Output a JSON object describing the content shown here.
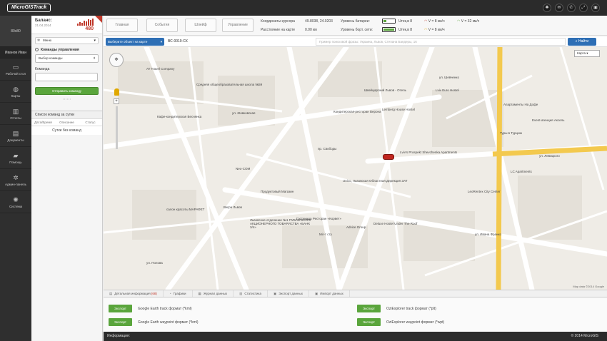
{
  "app": {
    "logo": "MicroGISTrack",
    "footer_label": "Информация:",
    "copyright": "© 2014 MicroGIS"
  },
  "user": {
    "avatar": "80x80",
    "name": "Иванов Иван"
  },
  "nav": [
    {
      "label": "Рабочий стол",
      "icon": "monitor-icon",
      "glyph": "▭"
    },
    {
      "label": "Карты",
      "icon": "globe-icon",
      "glyph": "◍"
    },
    {
      "label": "Отчеты",
      "icon": "bar-chart-icon",
      "glyph": "▥"
    },
    {
      "label": "Документы",
      "icon": "document-icon",
      "glyph": "▤"
    },
    {
      "label": "Помощь",
      "icon": "chat-icon",
      "glyph": "▰"
    },
    {
      "label": "Админ-панель",
      "icon": "gear-icon",
      "glyph": "✲"
    },
    {
      "label": "Система",
      "icon": "cog-icon",
      "glyph": "✺"
    }
  ],
  "balance": {
    "label": "Баланс:",
    "date": "21.04.2014",
    "value": "480"
  },
  "side": {
    "menu": "Меню",
    "commands_title": "Команды управления",
    "command_select": "Выбор команды",
    "command_label": "Команда",
    "send_button": "Отправить команду",
    "list_title": "Список команд за сутки",
    "columns": [
      "Дата/Время",
      "Описание",
      "Статус"
    ],
    "empty": "Сутки без команд"
  },
  "toolbar": {
    "tabs": [
      "Главная",
      "События",
      "Шлейф",
      "Управление"
    ],
    "coords_label": "Координаты курсора",
    "coords_value": "49.8038, 24.0203",
    "distance_label": "Расстояние на карте",
    "distance_value": "0.00 км",
    "battery_label": "Уровень батареи:",
    "battery_value": "Uтек,в 8",
    "onboard_label": "Уровень борт. сети:",
    "onboard_value": "Uтек,в 8",
    "speed1": "V = 8 км/ч",
    "speed2": "V = 32 км/ч",
    "speed3": "V = 8 км/ч"
  },
  "search": {
    "object_select": "Выберите объект на карте",
    "object_value": "ВС-0019-СК",
    "address_placeholder": "Пример поисковой фразы: Украина, Львов, Степана Бандеры, 16",
    "find_button": "Найти"
  },
  "map": {
    "type": "Карта",
    "copyright": "Map data ©2014 Google",
    "labels": [
      "AT Travel Company",
      "Средняя общеобразовательная школа №59",
      "Кафе-кондитерская Веснянка",
      "ул. Жовковская",
      "Neo-COM",
      "Продуктовый Магазин",
      "салон красоты МАРАФЕТ",
      "Вигра Львов",
      "Львовское отделение №1 ПУБЛИЧНОГО АКЦИОНЕРНОГО ТОВАРИСТВА «БАНК 3/4»",
      "Гостиница Ресторан «Корвет»",
      "Мiг-т сту",
      "Advice Group",
      "Deluxe Hostel Under The Roof",
      "Uniсо, Львовская Областная Дирекция ЗАТ",
      "Lviv's Prospekt Shevchenka Apartments",
      "Lemberg House Hostel",
      "Кондитерская-ресторан Верона",
      "Швейцарский Львов - Отель",
      "Lviv Euro Hostel",
      "Апартаменты На Дофе",
      "Event-агенция Аксель",
      "Туры в Турцию",
      "LC Apartments",
      "LeoRentex City Center",
      "ул. Левицкого",
      "ул. Ивана Франко",
      "ул. Шевченко",
      "пр. Свободы",
      "ул. Попова"
    ]
  },
  "bottom_tabs": [
    {
      "icon": "list-icon",
      "label": "Детальная информация",
      "count": "(68)"
    },
    {
      "icon": "chart-icon",
      "label": "Графики",
      "count": ""
    },
    {
      "icon": "log-icon",
      "label": "Журнал данных",
      "count": ""
    },
    {
      "icon": "stats-icon",
      "label": "Статистика",
      "count": ""
    },
    {
      "icon": "export-icon",
      "label": "Экспорт данных",
      "count": ""
    },
    {
      "icon": "import-icon",
      "label": "Импорт данных",
      "count": ""
    }
  ],
  "exports": {
    "button": "Экспорт",
    "items": [
      "Google Earth track формат (*kml)",
      "Google Earth waypoint формат (*kml)",
      "OziExplorer track формат (*plt)",
      "OziExplorer waypoint формат (*wpt)"
    ]
  },
  "colors": {
    "accent": "#2e6fb5",
    "success": "#5aa53c",
    "danger": "#c0392b",
    "dark": "#2b2b2b"
  }
}
